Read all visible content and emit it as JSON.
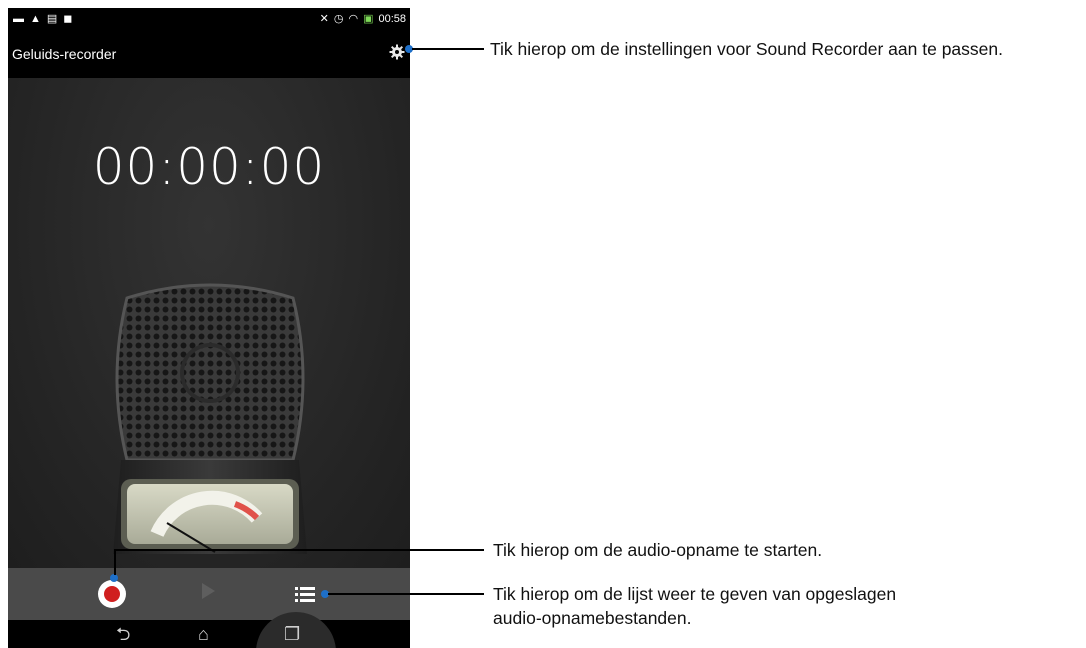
{
  "status_bar": {
    "left_icons": [
      "gallery-icon",
      "warning-icon",
      "message-icon",
      "sd-card-icon"
    ],
    "right_icons": [
      "mute-icon",
      "alarm-icon",
      "wifi-icon",
      "battery-charging-icon"
    ],
    "time": "00:58"
  },
  "app": {
    "title": "Geluids-recorder",
    "settings_icon": "gear-icon"
  },
  "recorder": {
    "timer": "00:00:00"
  },
  "controls": {
    "record_icon": "record-icon",
    "play_icon": "play-icon",
    "list_icon": "list-icon"
  },
  "navigation": {
    "back_icon": "back-icon",
    "home_icon": "home-icon",
    "recents_icon": "recents-icon"
  },
  "callouts": {
    "settings": "Tik hierop om de instellingen voor Sound Recorder aan te passen.",
    "record": "Tik hierop om de audio-opname te starten.",
    "list_line1": "Tik hierop om de lijst weer te geven van opgeslagen",
    "list_line2": "audio-opnamebestanden."
  },
  "colors": {
    "callout_dot": "#1e6fc8",
    "record_dot": "#d01f1f",
    "meter_needle_zone": "#e0524a"
  }
}
